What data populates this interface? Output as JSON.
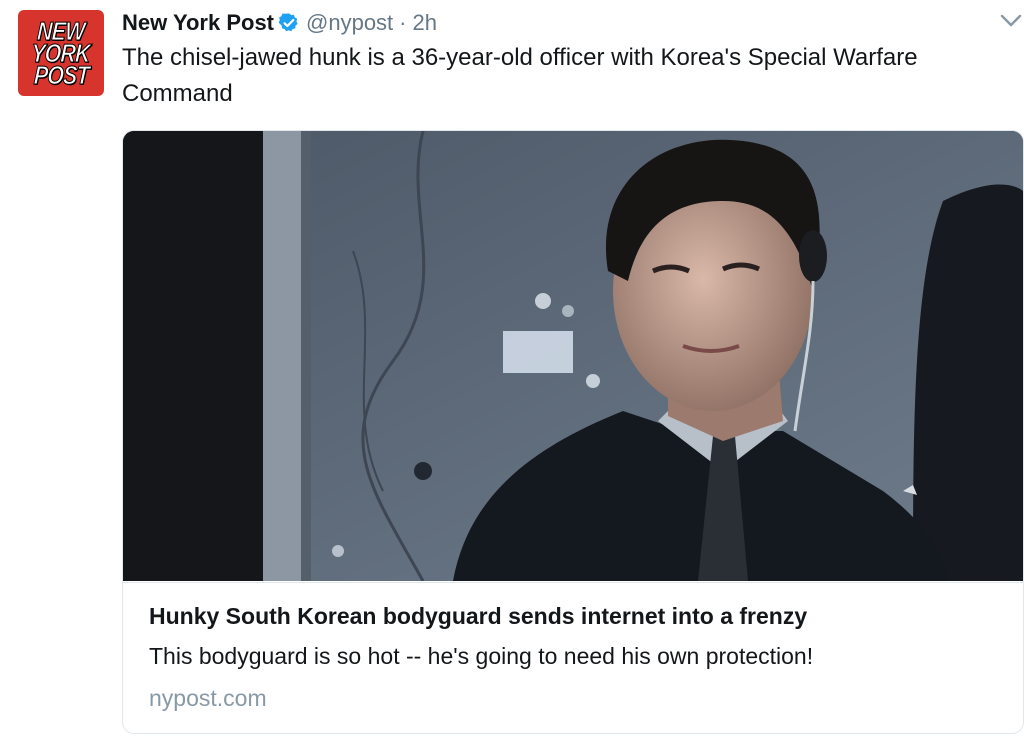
{
  "tweet": {
    "author": {
      "name": "New York Post",
      "handle": "@nypost",
      "separator": "·",
      "time": "2h",
      "avatar_lines": [
        "NEW",
        "YORK",
        "POST"
      ],
      "verified_icon": "verified-badge-icon"
    },
    "text": "The chisel-jawed hunk is a 36-year-old officer with Korea's Special Warfare Command",
    "menu_icon": "chevron-down-icon",
    "card": {
      "title": "Hunky South Korean bodyguard sends internet into a frenzy",
      "description": "This bodyguard is so hot -- he's going to need his own protection!",
      "domain": "nypost.com"
    }
  },
  "colors": {
    "brand_red": "#d6342c",
    "verified_blue": "#1da1f2",
    "secondary_text": "#657786",
    "domain_text": "#8899a6",
    "border": "#e1e8ed"
  }
}
